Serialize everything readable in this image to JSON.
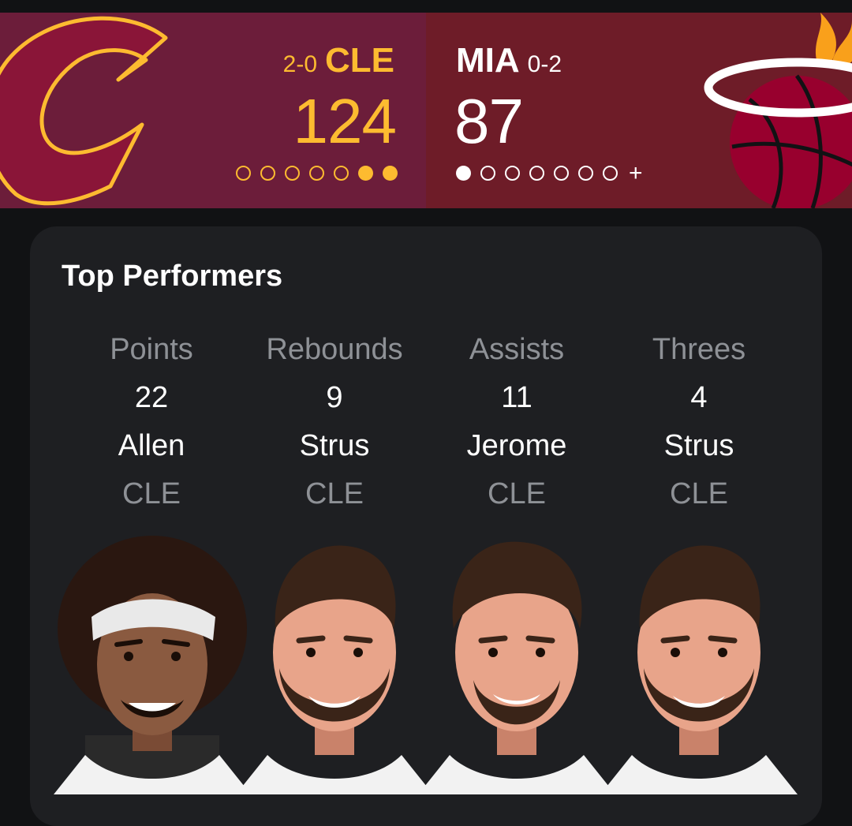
{
  "scoreboard": {
    "away": {
      "abbr": "CLE",
      "record": "2-0",
      "score": "124",
      "color": "#fdbb30",
      "bg": "#6c1d3a",
      "timeouts": [
        "empty",
        "empty",
        "empty",
        "empty",
        "empty",
        "full",
        "full"
      ]
    },
    "home": {
      "abbr": "MIA",
      "record": "0-2",
      "score": "87",
      "color": "#ffffff",
      "bg": "#6e1c28",
      "timeouts": [
        "full",
        "empty",
        "empty",
        "empty",
        "empty",
        "empty",
        "empty"
      ],
      "extra": "+"
    }
  },
  "top_performers": {
    "title": "Top Performers",
    "stats": [
      {
        "category": "Points",
        "value": "22",
        "player": "Allen",
        "team": "CLE",
        "avatar": "allen-headshot"
      },
      {
        "category": "Rebounds",
        "value": "9",
        "player": "Strus",
        "team": "CLE",
        "avatar": "strus-headshot"
      },
      {
        "category": "Assists",
        "value": "11",
        "player": "Jerome",
        "team": "CLE",
        "avatar": "jerome-headshot"
      },
      {
        "category": "Threes",
        "value": "4",
        "player": "Strus",
        "team": "CLE",
        "avatar": "strus-headshot"
      }
    ]
  }
}
